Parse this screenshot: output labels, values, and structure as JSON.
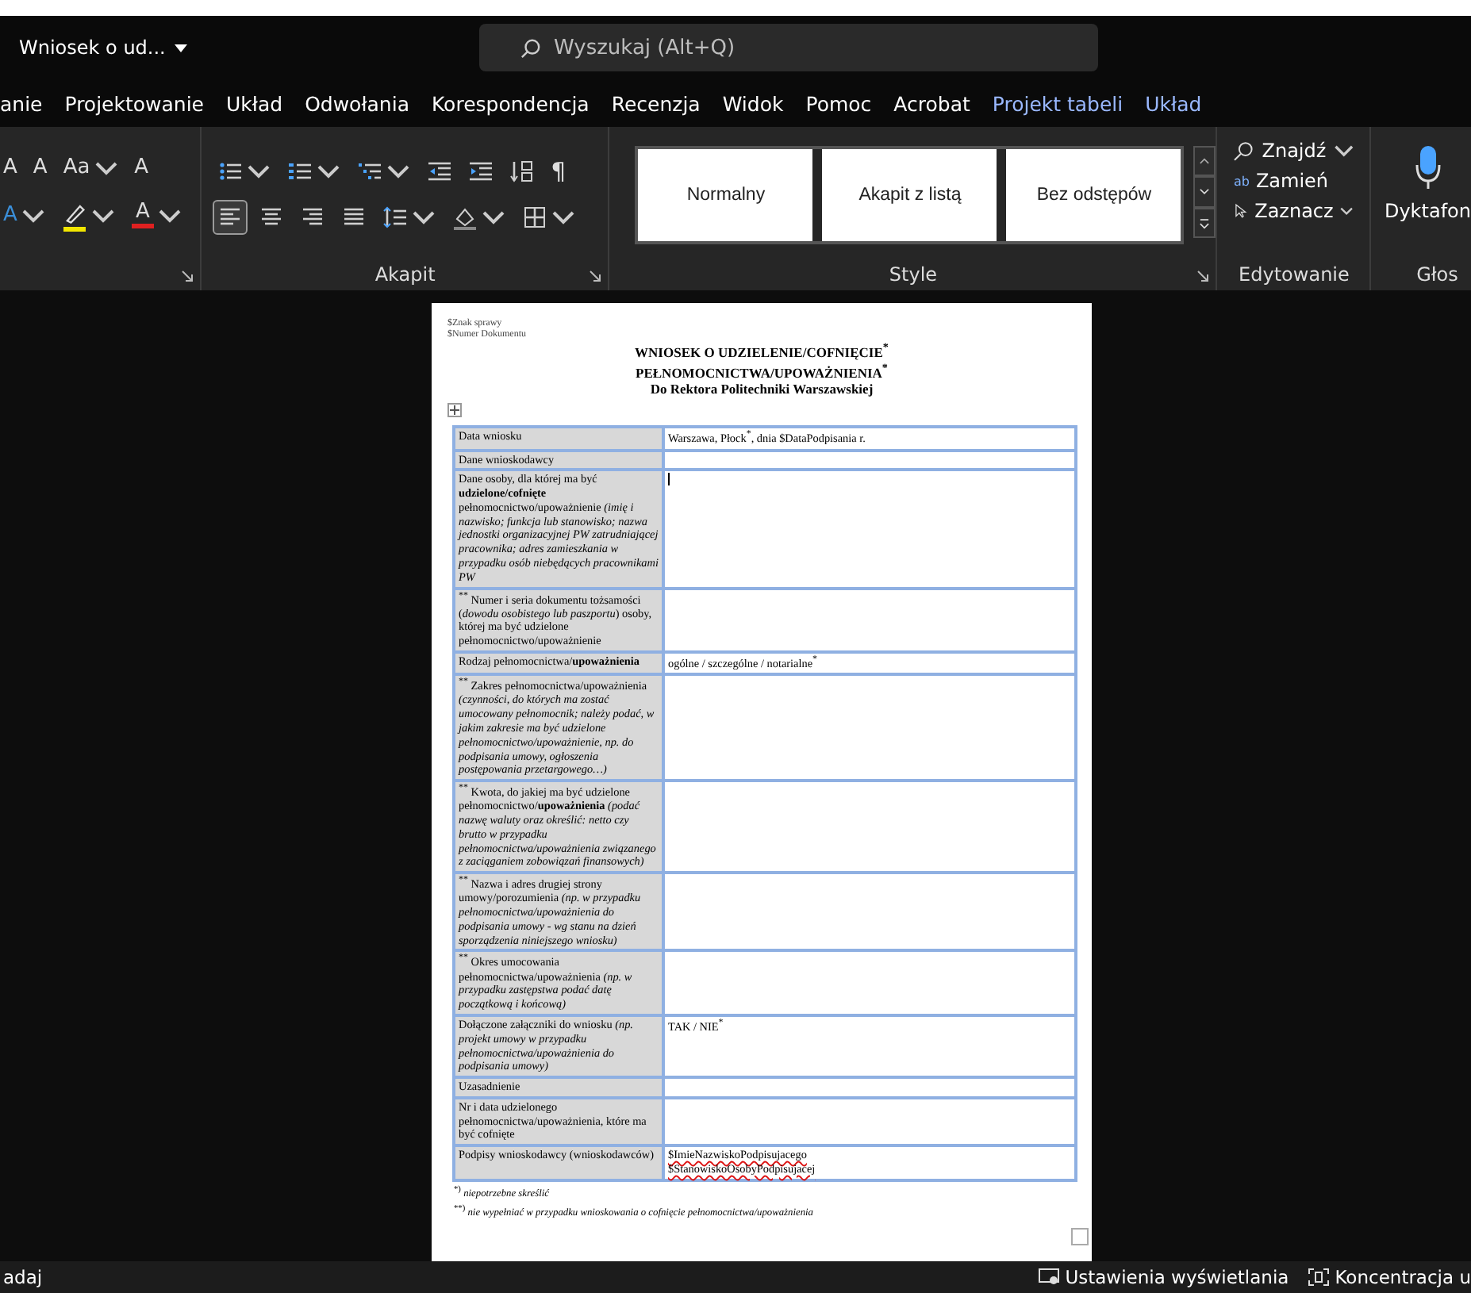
{
  "title_bar": {
    "document_title": "Wniosek o ud...",
    "search": {
      "placeholder": "Wyszukaj (Alt+Q)"
    }
  },
  "ribbon_tabs": [
    {
      "label": "anie",
      "contextual": false
    },
    {
      "label": "Projektowanie",
      "contextual": false
    },
    {
      "label": "Układ",
      "contextual": false
    },
    {
      "label": "Odwołania",
      "contextual": false
    },
    {
      "label": "Korespondencja",
      "contextual": false
    },
    {
      "label": "Recenzja",
      "contextual": false
    },
    {
      "label": "Widok",
      "contextual": false
    },
    {
      "label": "Pomoc",
      "contextual": false
    },
    {
      "label": "Acrobat",
      "contextual": false
    },
    {
      "label": "Projekt tabeli",
      "contextual": true
    },
    {
      "label": "Układ",
      "contextual": true
    }
  ],
  "font_group": {
    "row1": [
      {
        "kind": "grow",
        "text": "A"
      },
      {
        "kind": "shrink",
        "text": "A"
      },
      {
        "kind": "case",
        "text": "Aa"
      },
      {
        "kind": "clear",
        "text": "A"
      }
    ],
    "row2": [
      {
        "kind": "effects",
        "text": "A",
        "color": "#3b8fd9"
      },
      {
        "kind": "highlight",
        "color": "#f2e600"
      },
      {
        "kind": "fontcolor",
        "text": "A",
        "color": "#e02020"
      }
    ]
  },
  "paragraph_group": {
    "label": "Akapit",
    "row1": [
      {
        "kind": "bullets",
        "selected": false
      },
      {
        "kind": "numbering",
        "selected": false
      },
      {
        "kind": "multilevel",
        "selected": false
      },
      {
        "kind": "outdent",
        "selected": false
      },
      {
        "kind": "indent",
        "selected": false
      },
      {
        "kind": "sort",
        "selected": false
      },
      {
        "kind": "pilcrow",
        "text": "¶",
        "selected": false
      }
    ],
    "row2": [
      {
        "kind": "left",
        "selected": true
      },
      {
        "kind": "center",
        "selected": false
      },
      {
        "kind": "right",
        "selected": false
      },
      {
        "kind": "justify",
        "selected": false
      },
      {
        "kind": "spacing",
        "selected": false
      },
      {
        "kind": "shading",
        "selected": false
      },
      {
        "kind": "borders",
        "selected": false
      }
    ]
  },
  "styles_group": {
    "label": "Style",
    "styles": [
      "Normalny",
      "Akapit z listą",
      "Bez odstępów"
    ]
  },
  "editing_group": {
    "label": "Edytowanie",
    "items": [
      {
        "kind": "find",
        "label": "Znajdź"
      },
      {
        "kind": "replace",
        "label": "Zamień",
        "icon_text": "ab"
      },
      {
        "kind": "select",
        "label": "Zaznacz"
      }
    ]
  },
  "voice_group": {
    "label": "Głos",
    "button": "Dyktafon"
  },
  "document": {
    "header_lines": [
      "$Znak sprawy",
      "$Numer Dokumentu"
    ],
    "title_lines": [
      "WNIOSEK O UDZIELENIE/COFNIĘCIE$^{*}$",
      "PEŁNOMOCNICTWA/UPOWAŻNIENIA$^{*}$",
      "Do Rektora Politechniki Warszawskiej"
    ],
    "rows": [
      {
        "label": "Data wniosku",
        "value": [
          "Warszawa, Płock$^{*}$, dnia $DataPodpisania r."
        ]
      },
      {
        "label": "Dane wnioskodawcy"
      },
      {
        "label": "Dane osoby, dla której ma być **udzielone/cofnięte** pełnomocnictwo/upoważnienie *(imię i nazwisko; funkcja lub stanowisko; nazwa jednostki organizacyjnej PW zatrudniającej pracownika; adres zamieszkania w przypadku osób niebędących pracownikami PW*",
        "cursor": true
      },
      {
        "label": "$^{**}$ Numer i seria dokumentu tożsamości (*dowodu osobistego lub paszportu*) osoby, której ma być udzielone pełnomocnictwo/upoważnienie"
      },
      {
        "label": "Rodzaj pełnomocnictwa/**upoważnienia**",
        "value": [
          "ogólne / szczególne / notarialne$^{*}$"
        ]
      },
      {
        "label": "$^{**}$ Zakres pełnomocnictwa/upoważnienia *(czynności, do których ma zostać umocowany pełnomocnik; należy podać, w jakim zakresie ma być udzielone pełnomocnictwo/upoważnienie, np. do podpisania umowy, ogłoszenia postępowania przetargowego…)*"
      },
      {
        "label": "$^{**}$ Kwota, do jakiej ma być udzielone pełnomocnictwo/**upoważnienia** *(podać nazwę waluty oraz określić: netto czy brutto w przypadku pełnomocnictwa/upoważnienia związanego z zaciąganiem zobowiązań finansowych)*"
      },
      {
        "label": "$^{**}$ Nazwa i adres drugiej strony umowy/porozumienia *(np. w przypadku pełnomocnictwa/upoważnienia do podpisania umowy - wg stanu na dzień sporządzenia niniejszego wniosku)*"
      },
      {
        "label": "$^{**}$ Okres umocowania pełnomocnictwa/upoważnienia *(np. w przypadku zastępstwa podać datę początkową i końcową)*"
      },
      {
        "label": "Dołączone załączniki do wniosku *(np. projekt umowy w przypadku pełnomocnictwa/upoważnienia do podpisania umowy)*",
        "value": [
          "TAK / NIE$^{*}$"
        ]
      },
      {
        "label": "Uzasadnienie"
      },
      {
        "label": "Nr i data udzielonego pełnomocnictwa/upoważnienia, które ma być cofnięte"
      },
      {
        "label": "Podpisy wnioskodawcy (wnioskodawców)",
        "value": [
          "$ImieNazwiskoPodpisujacego",
          "$StanowiskoOsobyPodpisujacej"
        ],
        "misspelled": true
      }
    ],
    "footnotes": [
      "$^{*)}$ *niepotrzebne skreślić*",
      "$^{**)}$ *nie wypełniać w przypadku wnioskowania o cofnięcie pełnomocnictwa/upoważnienia*"
    ]
  },
  "status_bar": {
    "left": "adaj",
    "right": [
      {
        "kind": "display",
        "label": "Ustawienia wyświetlania"
      },
      {
        "kind": "focus",
        "label": "Koncentracja u"
      }
    ]
  }
}
